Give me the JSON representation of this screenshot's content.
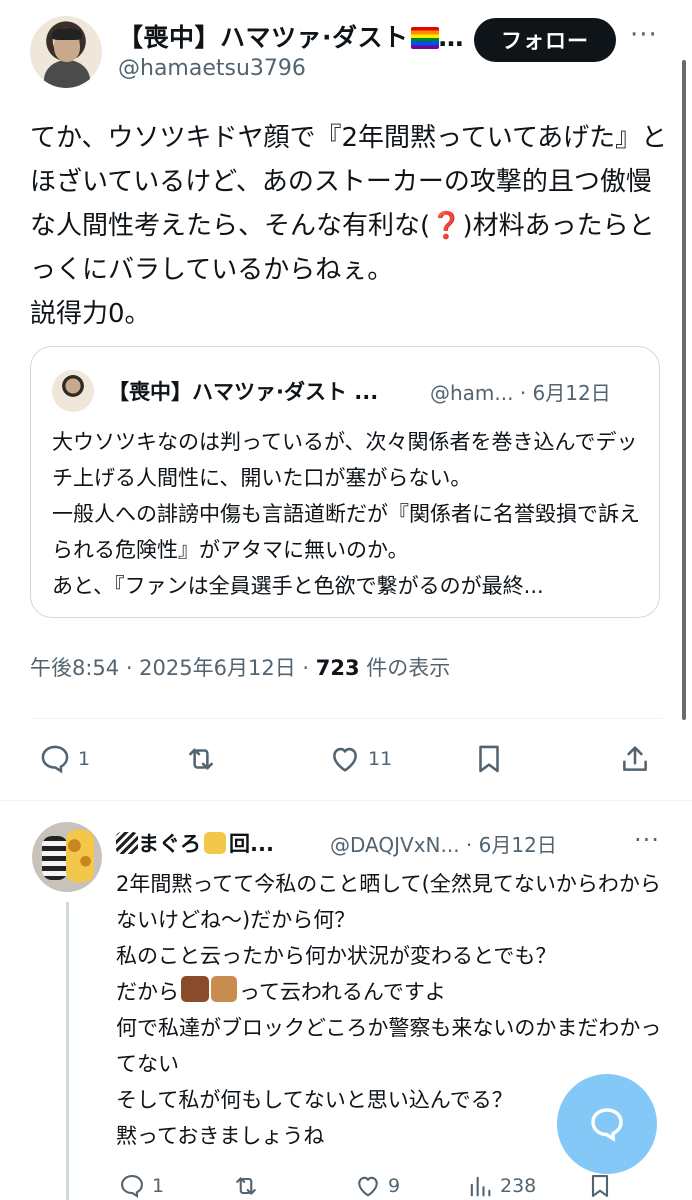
{
  "tweet": {
    "author_name": "【喪中】ハマツァ·ダスト",
    "author_handle": "@hamaetsu3796",
    "follow_label": "フォロー",
    "more_label": "···",
    "body_part1": "てか、ウソツキドヤ顔で『2年間黙っていてあげた』とほざいているけど、あのストーカーの攻撃的且つ傲慢な人間性考えたら、そんな有利な(",
    "body_emoji": "❓",
    "body_part2": ")材料あったらとっくにバラしているからねぇ。\n説得力0。",
    "time": "午後8:54 · 2025年6月12日 · ",
    "views": "723",
    "views_label": " 件の表示",
    "reply_count": "1",
    "like_count": "11"
  },
  "quote": {
    "author_name": "【喪中】ハマツァ·ダスト ...",
    "meta": "@ham... · 6月12日",
    "body": "大ウソツキなのは判っているが、次々関係者を巻き込んでデッチ上げる人間性に、開いた口が塞がらない。\n一般人への誹謗中傷も言語道断だが『関係者に名誉毀損で訴えられる危険性』がアタマに無いのか。\nあと、『ファンは全員選手と色欲で繋がるのが最終..."
  },
  "reply": {
    "author_name": "まぐろ",
    "author_name_suffix": "回...",
    "meta": "@DAQJVxN... · 6月12日",
    "more_label": "···",
    "body_part1": "2年間黙ってて今私のこと晒して(全然見てないからわからないけどね〜)だから何？\n私のこと云ったから何か状況が変わるとでも？\nだから",
    "body_part2": "って云われるんですよ\n何で私達がブロックどころか警察も来ないのかまだわかってない\nそして私が何もしてないと思い込んでる？\n黙っておきましょうね",
    "reply_count": "1",
    "like_count": "9",
    "view_count": "238"
  },
  "colors": {
    "text": "#0f1419",
    "secondary": "#536471",
    "border": "#cfd9de",
    "fab": "#1d9bf0"
  },
  "icons": [
    "reply-icon",
    "retweet-icon",
    "like-icon",
    "bookmark-icon",
    "share-icon",
    "views-icon",
    "compose-icon"
  ]
}
